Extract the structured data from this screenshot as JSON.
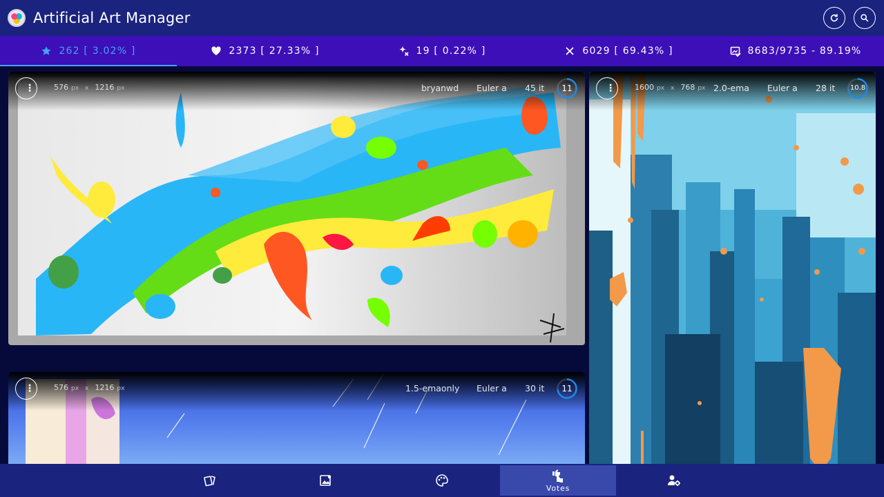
{
  "app": {
    "title": "Artificial Art Manager",
    "logo_icon": "palette-logo",
    "actions": [
      {
        "name": "refresh",
        "icon": "refresh-icon"
      },
      {
        "name": "search",
        "icon": "search-icon"
      }
    ]
  },
  "stats": [
    {
      "icon": "star-icon",
      "text": "262 [ 3.02% ]",
      "active": true
    },
    {
      "icon": "heart-icon",
      "text": "2373 [ 27.33% ]",
      "active": false
    },
    {
      "icon": "sparkle-cross-icon",
      "text": "19 [ 0.22% ]",
      "active": false
    },
    {
      "icon": "close-icon",
      "text": "6029 [ 69.43% ]",
      "active": false
    },
    {
      "icon": "image-check-icon",
      "text": "8683/9735 - 89.19%",
      "active": false
    }
  ],
  "cards": [
    {
      "width": "576",
      "height": "1216",
      "unit": "px",
      "x_sep": "x",
      "model": "bryanwd",
      "sampler": "Euler a",
      "steps": "45 it",
      "cfg": "11",
      "cfg_fraction": 0.73
    },
    {
      "width": "1600",
      "height": "768",
      "unit": "px",
      "x_sep": "x",
      "model": "2.0-ema",
      "sampler": "Euler a",
      "steps": "28 it",
      "cfg": "10.8",
      "cfg_fraction": 0.72
    },
    {
      "width": "576",
      "height": "1216",
      "unit": "px",
      "x_sep": "x",
      "model": "1.5-emaonly",
      "sampler": "Euler a",
      "steps": "30 it",
      "cfg": "11",
      "cfg_fraction": 0.73
    }
  ],
  "bottom_nav": [
    {
      "icon": "cards-icon",
      "label": "",
      "active": false
    },
    {
      "icon": "image-user-icon",
      "label": "",
      "active": false
    },
    {
      "icon": "palette-icon",
      "label": "",
      "active": false
    },
    {
      "icon": "thumbs-vote-icon",
      "label": "Votes",
      "active": true
    },
    {
      "icon": "user-settings-icon",
      "label": "",
      "active": false
    }
  ],
  "colors": {
    "appbar": "#1a237e",
    "stats_bar": "#3d0fb8",
    "active_accent": "#42a5f5",
    "background": "#060a3a",
    "gauge": "#1e88e5"
  }
}
